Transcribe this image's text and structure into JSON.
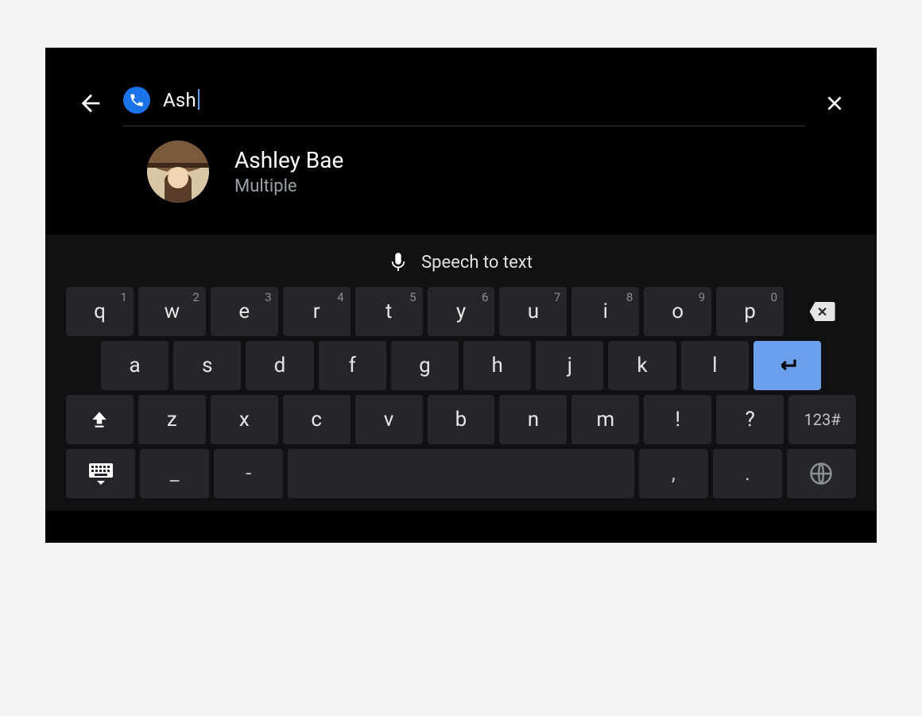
{
  "search": {
    "query": "Ash"
  },
  "results": [
    {
      "name": "Ashley Bae",
      "subtitle": "Multiple"
    }
  ],
  "keyboard": {
    "speech_label": "Speech to text",
    "row1": [
      {
        "label": "q",
        "hint": "1"
      },
      {
        "label": "w",
        "hint": "2"
      },
      {
        "label": "e",
        "hint": "3"
      },
      {
        "label": "r",
        "hint": "4"
      },
      {
        "label": "t",
        "hint": "5"
      },
      {
        "label": "y",
        "hint": "6"
      },
      {
        "label": "u",
        "hint": "7"
      },
      {
        "label": "i",
        "hint": "8"
      },
      {
        "label": "o",
        "hint": "9"
      },
      {
        "label": "p",
        "hint": "0"
      }
    ],
    "row2": [
      {
        "label": "a"
      },
      {
        "label": "s"
      },
      {
        "label": "d"
      },
      {
        "label": "f"
      },
      {
        "label": "g"
      },
      {
        "label": "h"
      },
      {
        "label": "j"
      },
      {
        "label": "k"
      },
      {
        "label": "l"
      }
    ],
    "row3": [
      {
        "label": "z"
      },
      {
        "label": "x"
      },
      {
        "label": "c"
      },
      {
        "label": "v"
      },
      {
        "label": "b"
      },
      {
        "label": "n"
      },
      {
        "label": "m"
      },
      {
        "label": "!"
      },
      {
        "label": "?"
      }
    ],
    "row4": {
      "underscore": "_",
      "dash": "-",
      "comma": ",",
      "period": ".",
      "sym": "123#"
    }
  }
}
